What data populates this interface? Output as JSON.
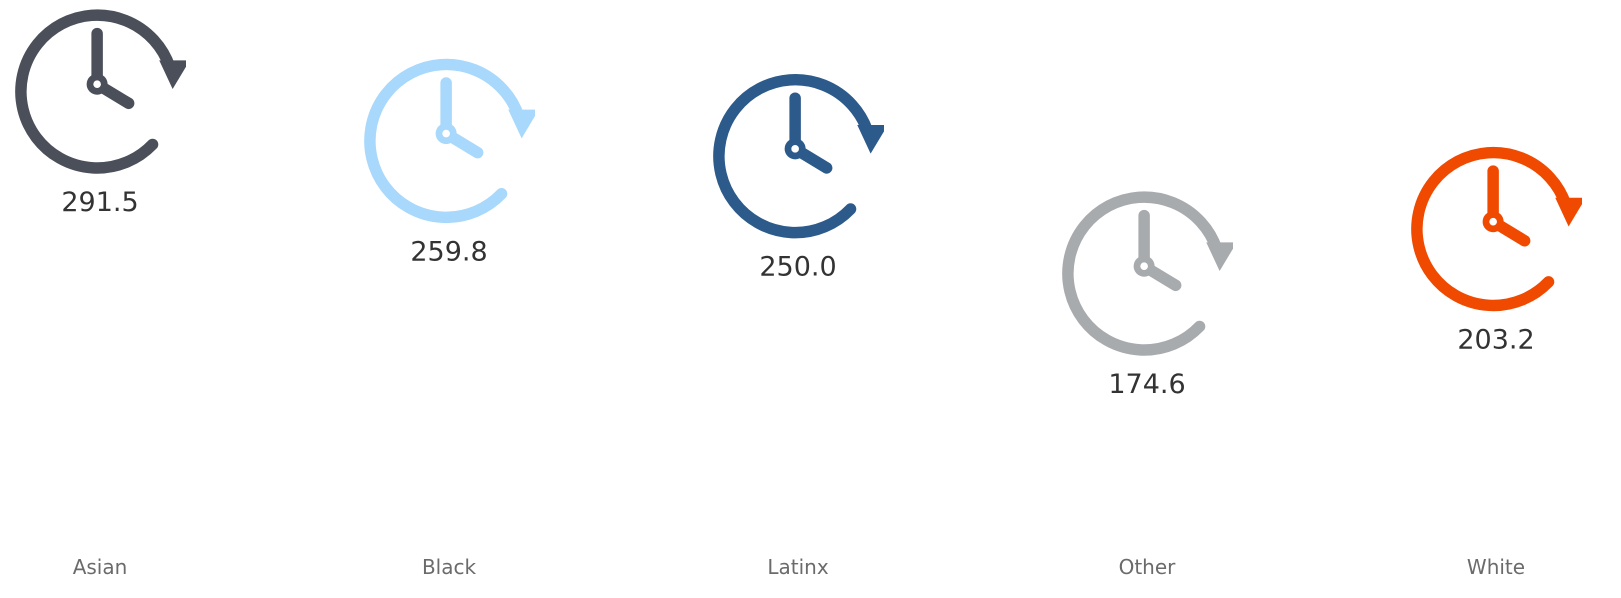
{
  "chart_data": {
    "type": "scatter",
    "title": "",
    "xlabel": "",
    "ylabel": "",
    "categories": [
      "Asian",
      "Black",
      "Latinx",
      "Other",
      "White"
    ],
    "values": [
      291.5,
      259.8,
      250.0,
      174.6,
      203.2
    ],
    "value_labels": [
      "291.5",
      "259.8",
      "250.0",
      "174.6",
      "203.2"
    ],
    "marker": "clock-history-icon",
    "colors": [
      "#4a4f5a",
      "#a8d8fb",
      "#2c5a8a",
      "#a8abae",
      "#f04a00"
    ],
    "ylim": [
      0,
      310
    ],
    "grid": false,
    "legend": "none"
  }
}
